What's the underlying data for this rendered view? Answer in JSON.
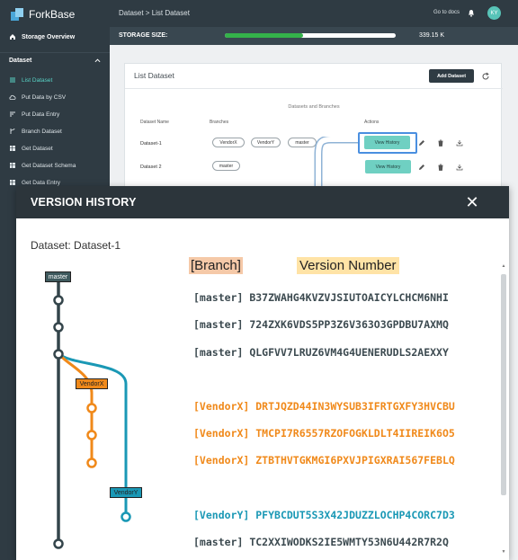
{
  "sidebar": {
    "brand": "ForkBase",
    "home": "Storage Overview",
    "section": "Dataset",
    "items": [
      {
        "label": "List Dataset",
        "icon": "list-icon"
      },
      {
        "label": "Put Data by CSV",
        "icon": "cloud-upload-icon"
      },
      {
        "label": "Put Data Entry",
        "icon": "sort-icon"
      },
      {
        "label": "Branch Dataset",
        "icon": "branch-icon"
      },
      {
        "label": "Get Dataset",
        "icon": "table-icon"
      },
      {
        "label": "Get Dataset Schema",
        "icon": "table-icon"
      },
      {
        "label": "Get Data Entry",
        "icon": "table-icon"
      }
    ]
  },
  "header": {
    "breadcrumb": "Dataset > List Dataset",
    "goto_docs": "Go to docs",
    "avatar": "KY",
    "storage_label": "STORAGE SIZE:",
    "storage_value": "339.15 K",
    "storage_fraction": 0.46
  },
  "card": {
    "title": "List Dataset",
    "add_button": "Add Dataset",
    "caption": "Datasets and Branches",
    "columns": [
      "Dataset Name",
      "Branches",
      "Actions"
    ],
    "rows": [
      {
        "name": "Dataset-1",
        "branches": [
          "VendorX",
          "VendorY",
          "master"
        ],
        "action": "View History"
      },
      {
        "name": "Dataset 2",
        "branches": [
          "master"
        ],
        "action": "View History"
      }
    ]
  },
  "modal": {
    "title": "VERSION HISTORY",
    "dataset_label": "Dataset: Dataset-1",
    "branch_header": "[Branch]",
    "version_header": "Version Number",
    "versions": [
      {
        "branch": "[master]",
        "version": "B37ZWAHG4KVZVJSIUTOAICYLCHCM6NHI",
        "kind": "master"
      },
      {
        "branch": "[master]",
        "version": "724ZXK6VDS5PP3Z6V363O3GPDBU7AXMQ",
        "kind": "master"
      },
      {
        "branch": "[master]",
        "version": "QLGFVV7LRUZ6VM4G4UENERUDLS2AEXXY",
        "kind": "master"
      },
      {
        "branch": "[VendorX]",
        "version": "DRTJQZD44IN3WYSUB3IFRTGXFY3HVCBU",
        "kind": "vendorx"
      },
      {
        "branch": "[VendorX]",
        "version": "TMCPI7R6557RZOFOGKLDLT4IIREIK6O5",
        "kind": "vendorx"
      },
      {
        "branch": "[VendorX]",
        "version": "ZTBTHVTGKMGI6PXVJPIGXRAI567FEBLQ",
        "kind": "vendorx"
      },
      {
        "branch": "[VendorY]",
        "version": "PFYBCDUT5S3X42JDUZZLOCHP4CORC7D3",
        "kind": "vendory"
      },
      {
        "branch": "[master]",
        "version": "TC2XXIWODKS2IE5WMTY53N6U442R7R2Q",
        "kind": "master"
      }
    ],
    "graph_tags": {
      "master": "master",
      "vendorx": "VendorX",
      "vendory": "VendorY"
    }
  },
  "colors": {
    "master": "#3c4a50",
    "vendorx": "#f0891a",
    "vendory": "#1a98b5",
    "accent": "#6fd0c2"
  }
}
